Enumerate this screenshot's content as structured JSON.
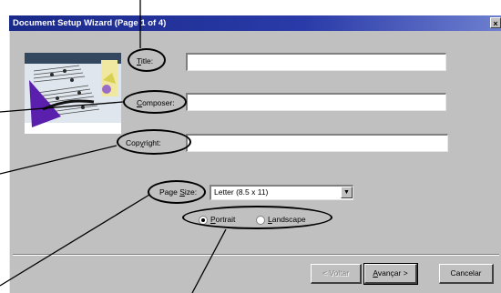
{
  "window": {
    "title": "Document Setup Wizard (Page 1 of 4)",
    "close_glyph": "×"
  },
  "fields": {
    "title_label_u": "T",
    "title_label_rest": "itle:",
    "title_value": "",
    "composer_label_u": "C",
    "composer_label_rest": "omposer:",
    "composer_value": "",
    "copyright_label_pre": "Cop",
    "copyright_label_u": "y",
    "copyright_label_rest": "right:",
    "copyright_value": ""
  },
  "page_size": {
    "label_pre": "Page ",
    "label_u": "S",
    "label_rest": "ize:",
    "selected": "Letter (8.5 x 11)"
  },
  "orientation": {
    "portrait_u": "P",
    "portrait_rest": "ortrait",
    "landscape_u": "L",
    "landscape_rest": "andscape",
    "selected": "portrait"
  },
  "buttons": {
    "back": "< Voltar",
    "next_u": "A",
    "next_rest": "vançar >",
    "cancel": "Cancelar"
  },
  "icons": {
    "art": "music-score-art",
    "combo_arrow": "chevron-down-icon"
  },
  "colors": {
    "titlebar": "#1a2a8a",
    "dialog": "#c0c0c0",
    "field": "#ffffff"
  }
}
